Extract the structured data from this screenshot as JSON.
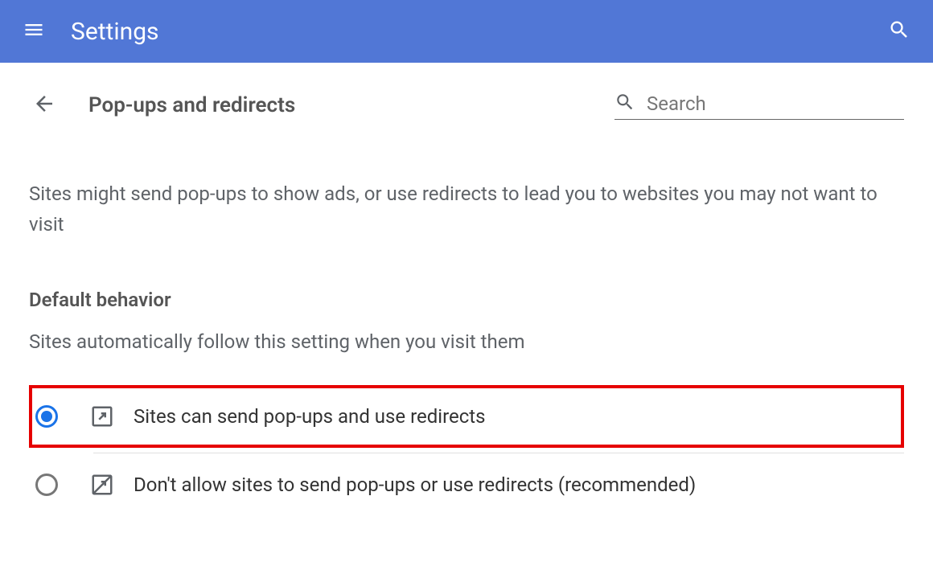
{
  "header": {
    "title": "Settings"
  },
  "page": {
    "title": "Pop-ups and redirects",
    "search_placeholder": "Search",
    "description": "Sites might send pop-ups to show ads, or use redirects to lead you to websites you may not want to visit"
  },
  "section": {
    "title": "Default behavior",
    "subtitle": "Sites automatically follow this setting when you visit them",
    "options": [
      {
        "label": "Sites can send pop-ups and use redirects",
        "selected": true,
        "highlighted": true
      },
      {
        "label": "Don't allow sites to send pop-ups or use redirects (recommended)",
        "selected": false,
        "highlighted": false
      }
    ]
  }
}
